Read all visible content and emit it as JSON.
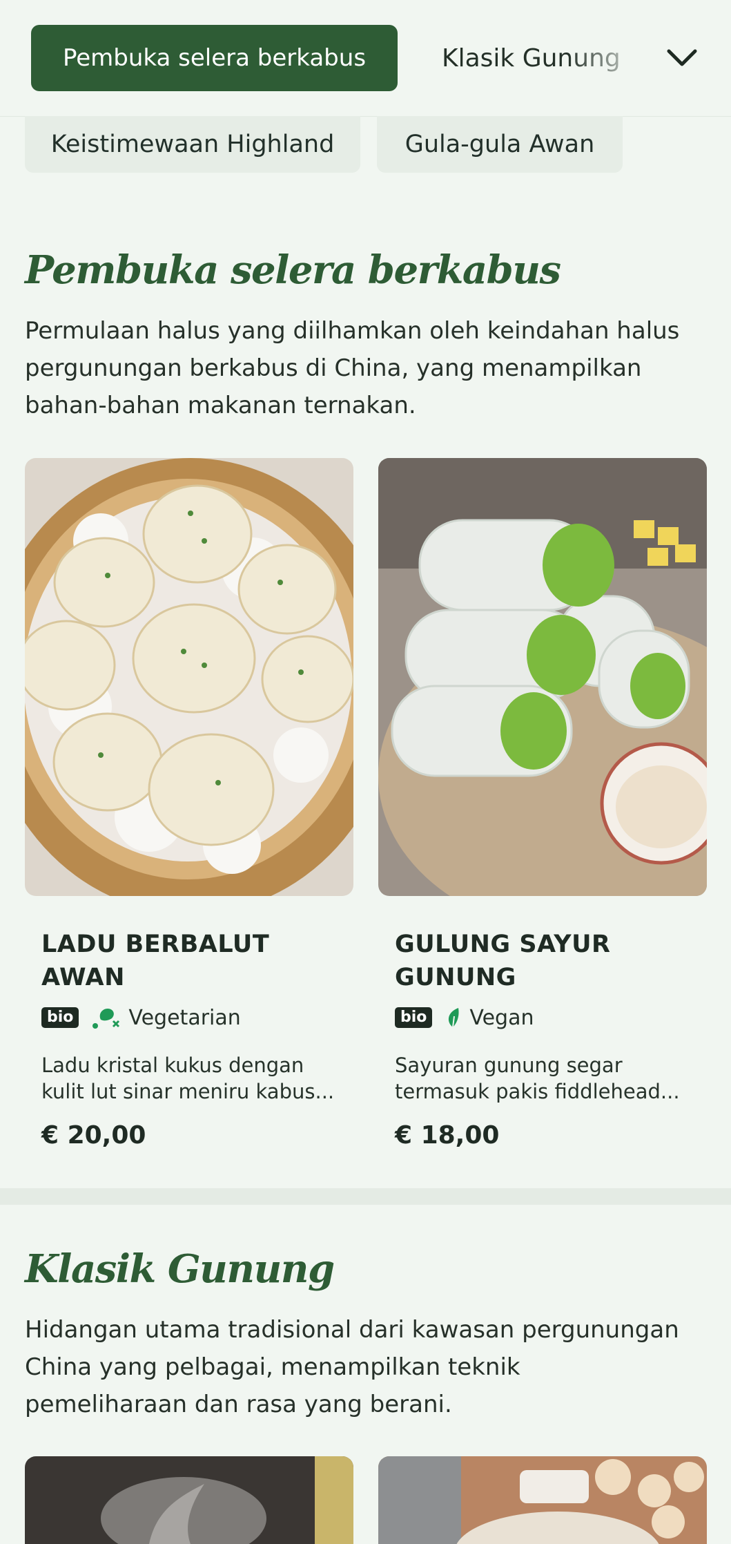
{
  "nav": {
    "active_tab": "Pembuka selera berkabus",
    "tab_2": "Klasik Gunung",
    "chips": [
      "Keistimewaan Highland",
      "Gula-gula Awan"
    ]
  },
  "sections": [
    {
      "title": "Pembuka selera berkabus",
      "description": "Permulaan halus yang diilhamkan oleh keindahan halus pergunungan berkabus di China, yang menampilkan bahan-bahan makanan ternakan.",
      "items": [
        {
          "name": "LADU BERBALUT AWAN",
          "badge": "bio",
          "diet": "Vegetarian",
          "diet_icon": "no-meat-icon",
          "description": "Ladu kristal kukus dengan kulit lut sinar meniru kabus...",
          "price": "€ 20,00"
        },
        {
          "name": "GULUNG SAYUR GUNUNG",
          "badge": "bio",
          "diet": "Vegan",
          "diet_icon": "leaf-icon",
          "description": "Sayuran gunung segar termasuk pakis fiddlehead...",
          "price": "€ 18,00"
        }
      ]
    },
    {
      "title": "Klasik Gunung",
      "description": "Hidangan utama tradisional dari kawasan pergunungan China yang pelbagai, menampilkan teknik pemeliharaan dan rasa yang berani."
    }
  ],
  "colors": {
    "accent": "#2e5c35",
    "background": "#f1f6f1",
    "diet_icon": "#1f9a57"
  }
}
